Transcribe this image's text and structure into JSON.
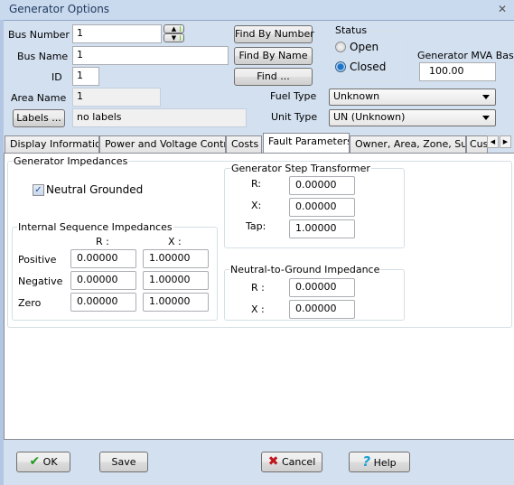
{
  "window": {
    "title": "Generator Options",
    "close_icon": "close-x"
  },
  "top": {
    "bus_number": {
      "label": "Bus Number",
      "value": "1"
    },
    "bus_name": {
      "label": "Bus Name",
      "value": "1"
    },
    "id": {
      "label": "ID",
      "value": "1"
    },
    "area_name": {
      "label": "Area Name",
      "value": "1"
    },
    "labels_button": "Labels ...",
    "labels_value": "no labels",
    "find_by_number": "Find By Number",
    "find_by_name": "Find By Name",
    "find": "Find ...",
    "status": {
      "title": "Status",
      "options": [
        "Open",
        "Closed"
      ],
      "selected": "Closed"
    },
    "mva_base": {
      "label": "Generator MVA Base",
      "value": "100.00"
    },
    "fuel_type": {
      "label": "Fuel Type",
      "value": "Unknown"
    },
    "unit_type": {
      "label": "Unit Type",
      "value": "UN (Unknown)"
    }
  },
  "tabs": [
    {
      "label": "Display Information"
    },
    {
      "label": "Power and Voltage Control"
    },
    {
      "label": "Costs"
    },
    {
      "label": "Fault Parameters",
      "active": true
    },
    {
      "label": "Owner, Area, Zone, Sub"
    },
    {
      "label": "Cus"
    }
  ],
  "fault": {
    "group_title": "Generator Impedances",
    "neutral_grounded": {
      "label": "Neutral Grounded",
      "checked": true
    },
    "internal": {
      "title": "Internal Sequence Impedances",
      "col_r": "R :",
      "col_x": "X :",
      "rows": [
        {
          "label": "Positive",
          "r": "0.00000",
          "x": "1.00000"
        },
        {
          "label": "Negative",
          "r": "0.00000",
          "x": "1.00000"
        },
        {
          "label": "Zero",
          "r": "0.00000",
          "x": "1.00000"
        }
      ]
    },
    "step_transformer": {
      "title": "Generator Step Transformer",
      "r_label": "R:",
      "r": "0.00000",
      "x_label": "X:",
      "x": "0.00000",
      "tap_label": "Tap:",
      "tap": "1.00000"
    },
    "neutral_ground": {
      "title": "Neutral-to-Ground Impedance",
      "r_label": "R :",
      "r": "0.00000",
      "x_label": "X :",
      "x": "0.00000"
    }
  },
  "buttons": {
    "ok": "OK",
    "save": "Save",
    "cancel": "Cancel",
    "help": "Help"
  },
  "colors": {
    "ok_check": "#1f9a1f",
    "cancel_x": "#c0151b",
    "help_q": "#1a9fd0"
  }
}
